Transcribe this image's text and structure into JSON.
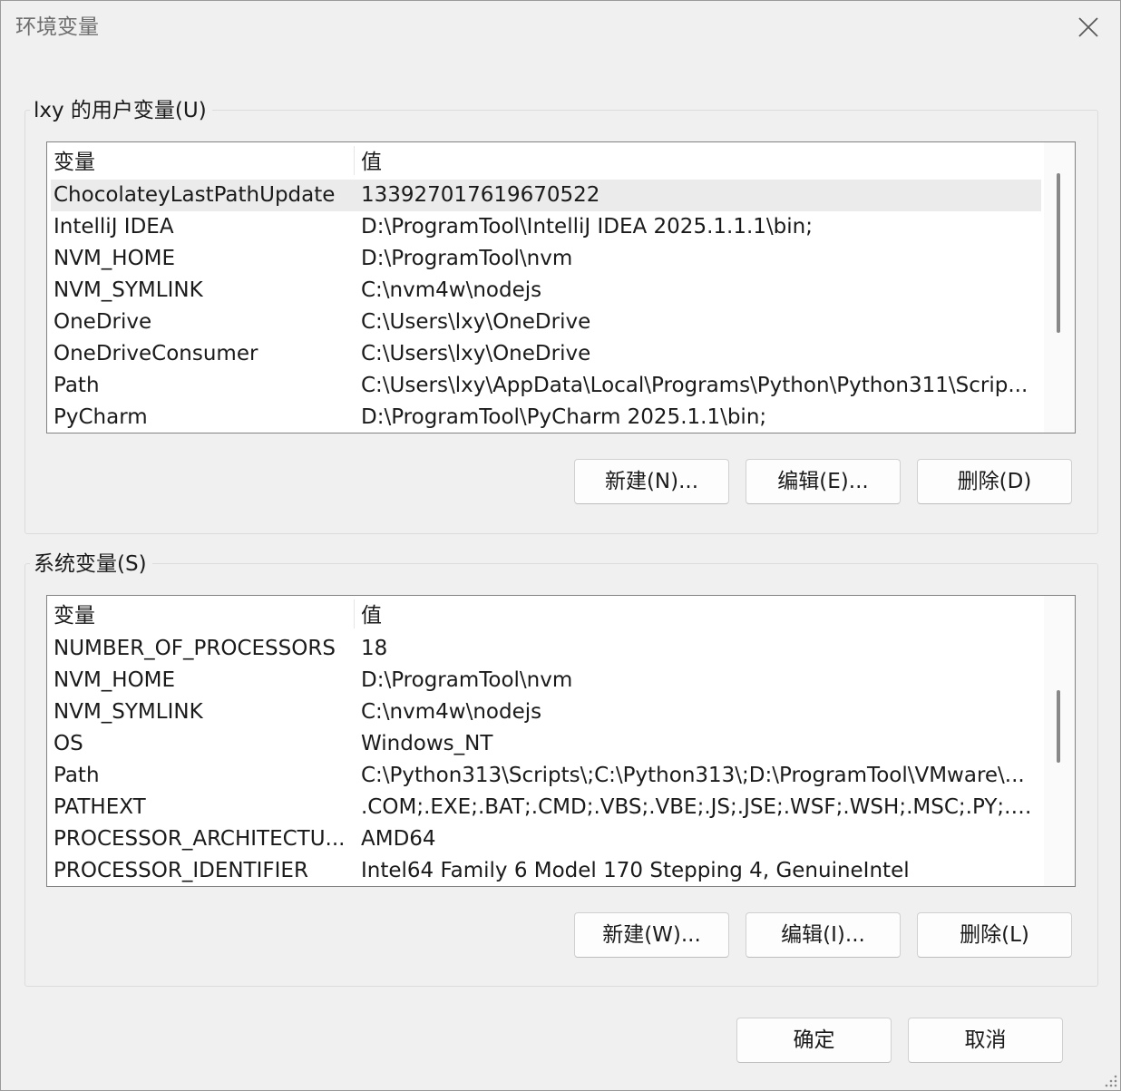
{
  "window": {
    "title": "环境变量"
  },
  "user_vars": {
    "legend": "lxy 的用户变量(U)",
    "columns": {
      "name": "变量",
      "value": "值"
    },
    "rows": [
      {
        "name": "ChocolateyLastPathUpdate",
        "value": "133927017619670522"
      },
      {
        "name": "IntelliJ IDEA",
        "value": "D:\\ProgramTool\\IntelliJ IDEA 2025.1.1.1\\bin;"
      },
      {
        "name": "NVM_HOME",
        "value": "D:\\ProgramTool\\nvm"
      },
      {
        "name": "NVM_SYMLINK",
        "value": "C:\\nvm4w\\nodejs"
      },
      {
        "name": "OneDrive",
        "value": "C:\\Users\\lxy\\OneDrive"
      },
      {
        "name": "OneDriveConsumer",
        "value": "C:\\Users\\lxy\\OneDrive"
      },
      {
        "name": "Path",
        "value": "C:\\Users\\lxy\\AppData\\Local\\Programs\\Python\\Python311\\Scrip..."
      },
      {
        "name": "PyCharm",
        "value": "D:\\ProgramTool\\PyCharm 2025.1.1\\bin;"
      }
    ],
    "buttons": {
      "new": "新建(N)...",
      "edit": "编辑(E)...",
      "delete": "删除(D)"
    }
  },
  "system_vars": {
    "legend": "系统变量(S)",
    "columns": {
      "name": "变量",
      "value": "值"
    },
    "rows": [
      {
        "name": "NUMBER_OF_PROCESSORS",
        "value": "18"
      },
      {
        "name": "NVM_HOME",
        "value": "D:\\ProgramTool\\nvm"
      },
      {
        "name": "NVM_SYMLINK",
        "value": "C:\\nvm4w\\nodejs"
      },
      {
        "name": "OS",
        "value": "Windows_NT"
      },
      {
        "name": "Path",
        "value": "C:\\Python313\\Scripts\\;C:\\Python313\\;D:\\ProgramTool\\VMware\\..."
      },
      {
        "name": "PATHEXT",
        "value": ".COM;.EXE;.BAT;.CMD;.VBS;.VBE;.JS;.JSE;.WSF;.WSH;.MSC;.PY;.PY..."
      },
      {
        "name": "PROCESSOR_ARCHITECTU...",
        "value": "AMD64"
      },
      {
        "name": "PROCESSOR_IDENTIFIER",
        "value": "Intel64 Family 6 Model 170 Stepping 4, GenuineIntel"
      }
    ],
    "buttons": {
      "new": "新建(W)...",
      "edit": "编辑(I)...",
      "delete": "删除(L)"
    }
  },
  "footer": {
    "ok": "确定",
    "cancel": "取消"
  },
  "icons": {
    "close": "close-icon",
    "grip": "resize-grip-icon"
  },
  "colors": {
    "selected_row": "#ebebeb",
    "background": "#f0f0f0"
  }
}
